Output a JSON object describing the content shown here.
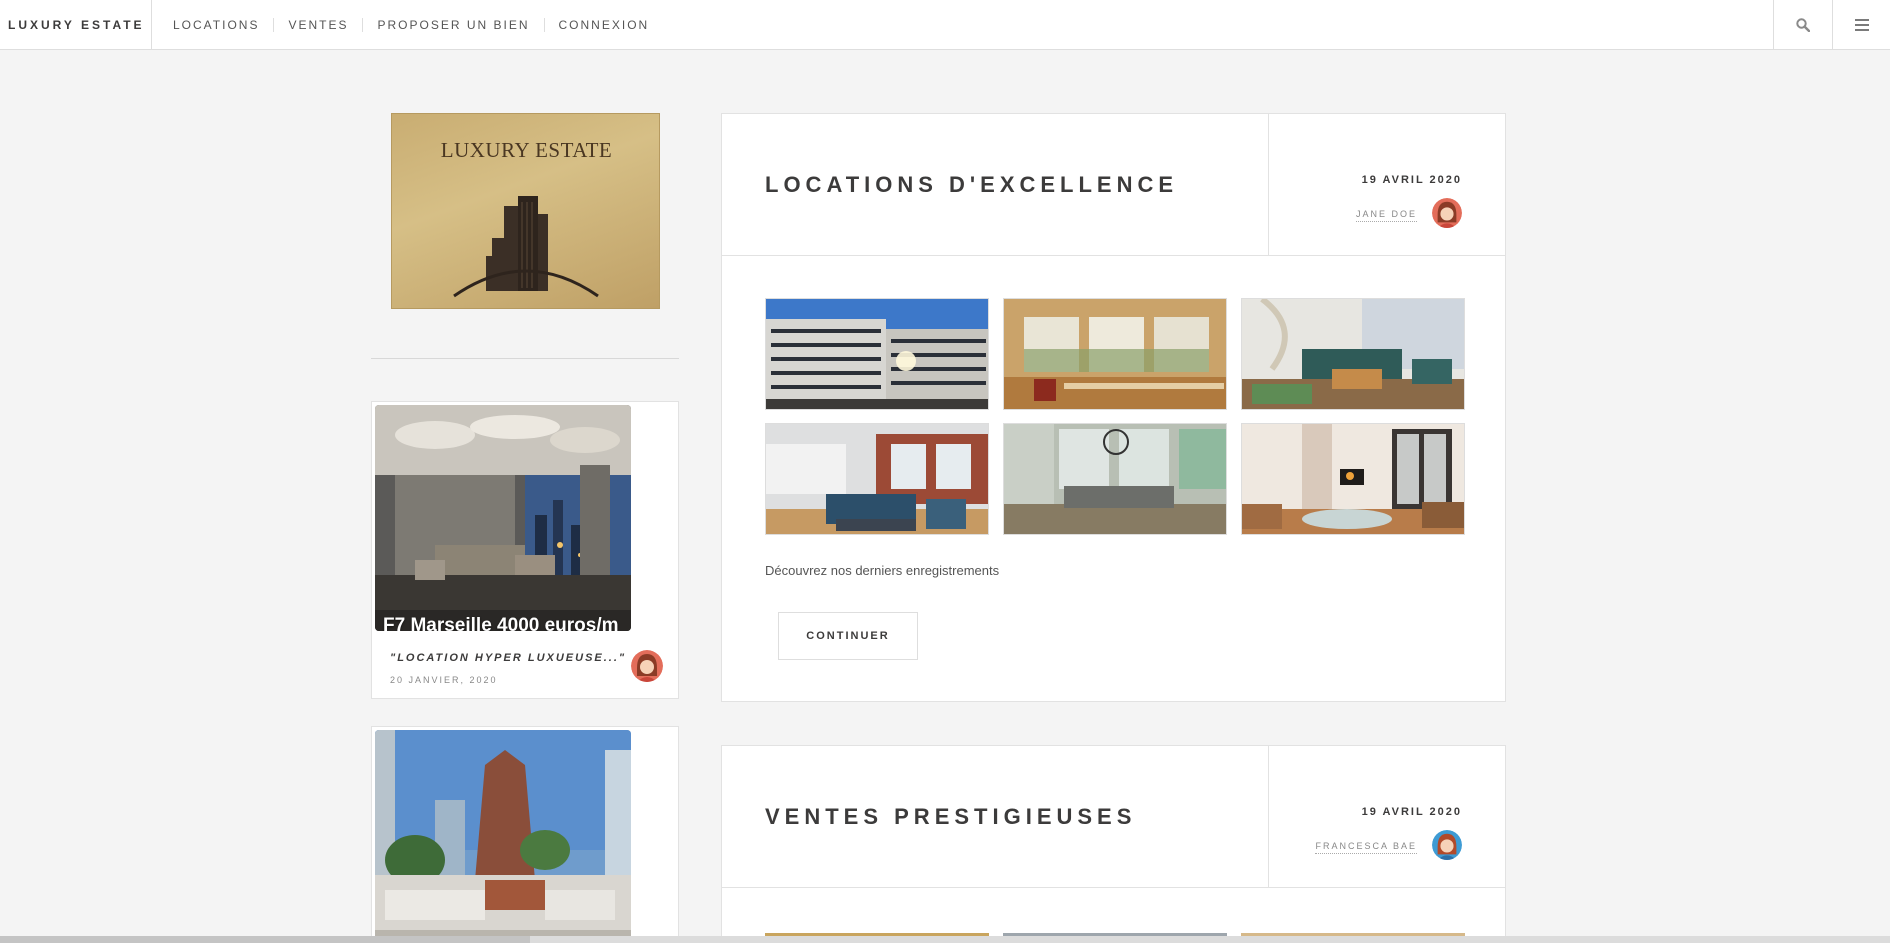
{
  "header": {
    "brand": "LUXURY ESTATE",
    "nav": [
      "LOCATIONS",
      "VENTES",
      "PROPOSER UN BIEN",
      "CONNEXION"
    ],
    "icons": [
      "search-icon",
      "hamburger-menu-icon"
    ]
  },
  "sidebar": {
    "logo_text": "LUXURY ESTATE",
    "mini_posts": [
      {
        "title": "F7 Marseille 4000 euros/m",
        "caption": "\"LOCATION HYPER LUXUEUSE...\"",
        "date": "20 JANVIER, 2020"
      },
      {
        "title": "",
        "caption": "",
        "date": ""
      }
    ]
  },
  "posts": [
    {
      "title": "LOCATIONS D'EXCELLENCE",
      "date": "19 AVRIL 2020",
      "author": "JANE DOE",
      "description": "Découvrez nos derniers enregistrements",
      "button": "CONTINUER"
    },
    {
      "title": "VENTES PRESTIGIEUSES",
      "date": "19 AVRIL 2020",
      "author": "FRANCESCA BAE"
    }
  ],
  "colors": {
    "background": "#f4f4f4",
    "text": "#3c3b3b",
    "gold": "#c9ad72"
  }
}
